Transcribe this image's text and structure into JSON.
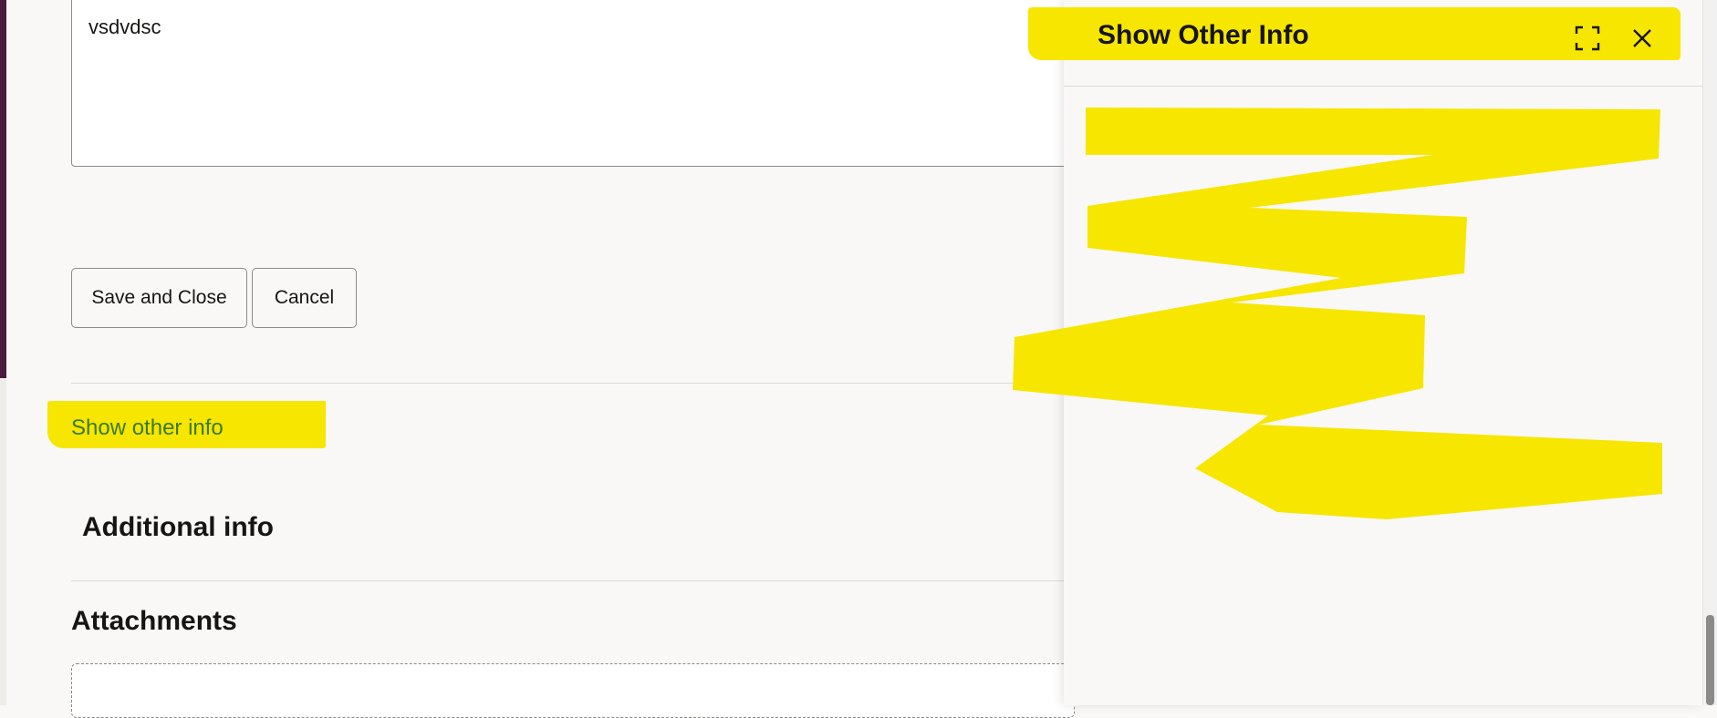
{
  "form": {
    "description_value": "vsdvdsc"
  },
  "actions": {
    "save_close_label": "Save and Close",
    "cancel_label": "Cancel"
  },
  "links": {
    "show_other_info": "Show other info"
  },
  "sections": {
    "additional_info": "Additional info",
    "attachments": "Attachments"
  },
  "drawer": {
    "title": "Show Other Info",
    "maximize_icon": "maximize-icon",
    "close_icon": "close-icon"
  },
  "colors": {
    "highlight": "#f7e600",
    "link": "#3b7a14",
    "accent_bar": "#4b1a3c"
  }
}
